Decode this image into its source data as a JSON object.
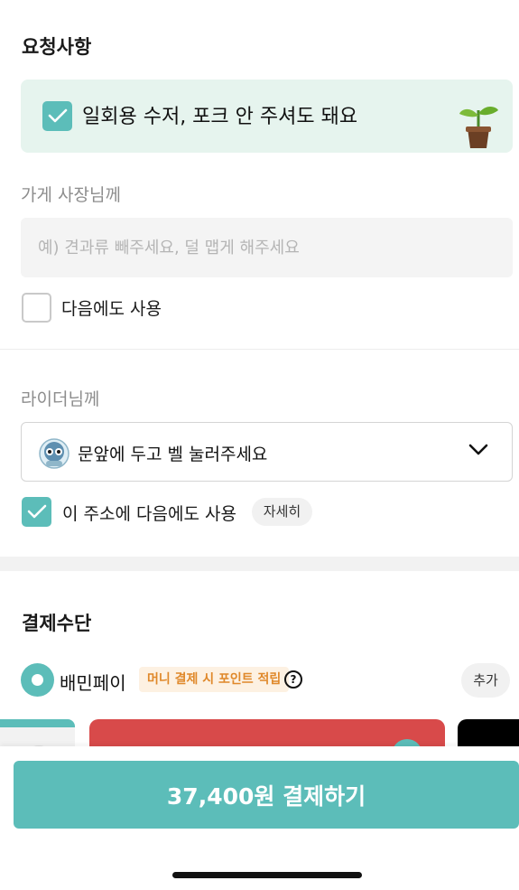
{
  "request": {
    "title": "요청사항",
    "eco_option": {
      "label": "일회용 수저, 포크 안 주셔도 돼요",
      "checked": true
    }
  },
  "store": {
    "label": "가게 사장님께",
    "placeholder": "예) 견과류 빼주세요, 덜 맵게 해주세요",
    "value": "",
    "reuse_label": "다음에도 사용",
    "reuse_checked": false
  },
  "rider": {
    "label": "라이더님께",
    "selected": "문앞에 두고 벨 눌러주세요",
    "reuse_label": "이 주소에 다음에도 사용",
    "reuse_checked": true,
    "details_label": "자세히"
  },
  "payment": {
    "title": "결제수단",
    "method_label": "배민페이",
    "promo": "머니 결제 시 포인트 적립",
    "help_icon": "?",
    "add_label": "추가"
  },
  "checkout": {
    "button_label": "37,400원 결제하기"
  },
  "colors": {
    "accent": "#5cbdb9",
    "eco_bg": "#e6f4ee",
    "promo_text": "#e0892b",
    "card_red": "#d84a4a"
  }
}
